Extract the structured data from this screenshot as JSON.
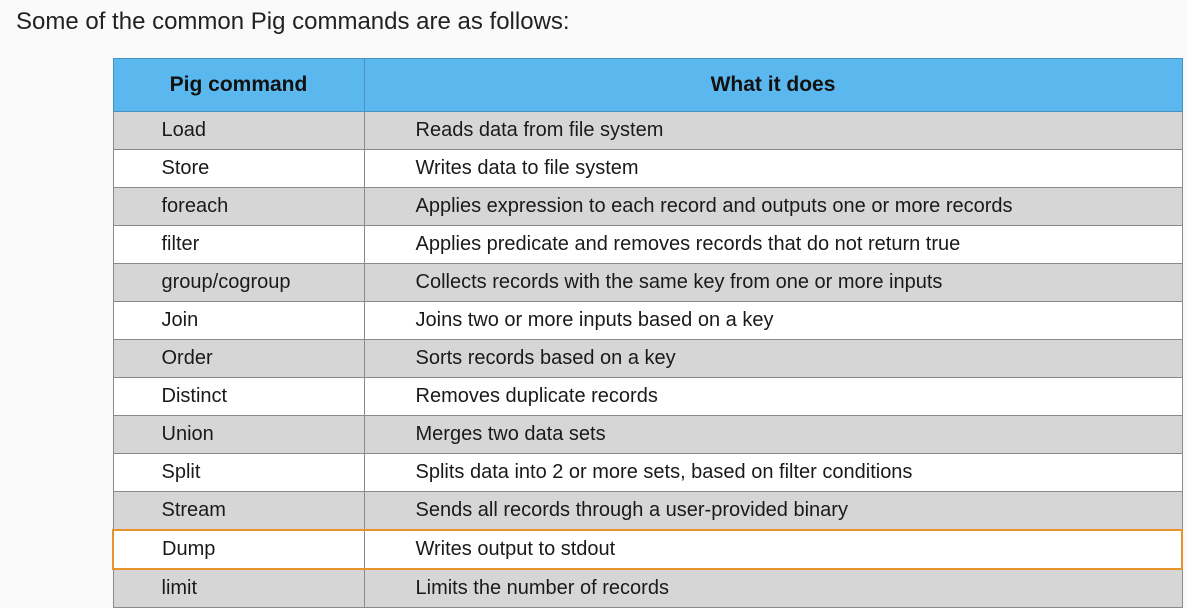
{
  "heading": "Some of the common Pig commands are as follows:",
  "table": {
    "headers": [
      "Pig command",
      "What it does"
    ],
    "rows": [
      {
        "command": "Load",
        "description": "Reads data from file system"
      },
      {
        "command": "Store",
        "description": "Writes data to file system"
      },
      {
        "command": "foreach",
        "description": "Applies expression to each record and outputs one or more records"
      },
      {
        "command": "filter",
        "description": "Applies predicate and removes records that do not return true"
      },
      {
        "command": "group/cogroup",
        "description": "Collects records with the same key from one or more inputs"
      },
      {
        "command": "Join",
        "description": "Joins two or more inputs based on a key"
      },
      {
        "command": "Order",
        "description": "Sorts records based on a key"
      },
      {
        "command": "Distinct",
        "description": "Removes duplicate records"
      },
      {
        "command": "Union",
        "description": "Merges two data sets"
      },
      {
        "command": "Split",
        "description": "Splits data into 2 or more sets, based on filter conditions"
      },
      {
        "command": "Stream",
        "description": "Sends all records through a user-provided binary"
      },
      {
        "command": "Dump",
        "description": "Writes output to stdout"
      },
      {
        "command": "limit",
        "description": "Limits the number of records"
      }
    ]
  },
  "colors": {
    "header_bg": "#5bb8ee",
    "shaded_row": "#d6d6d6",
    "highlight_border": "#e8922b"
  }
}
